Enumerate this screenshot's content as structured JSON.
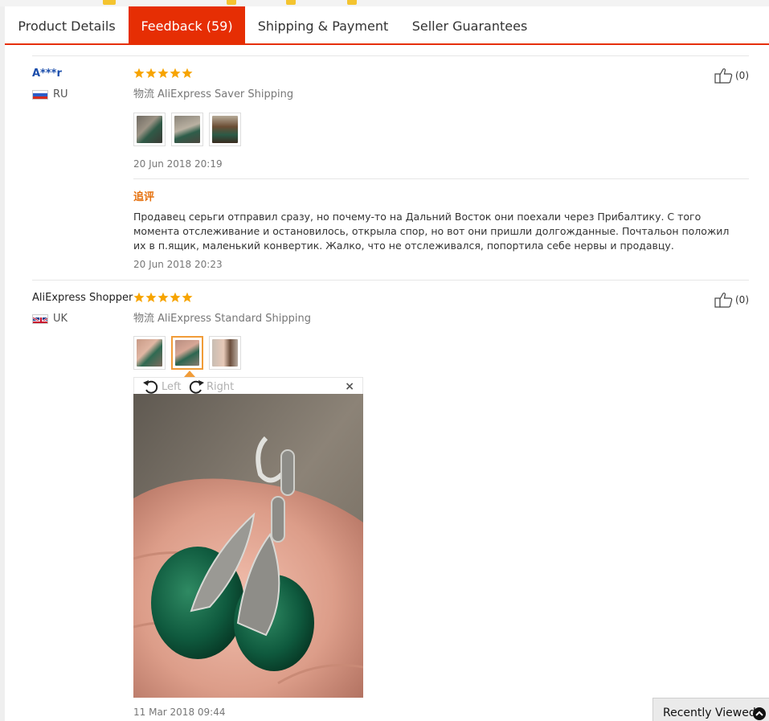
{
  "tabs": [
    {
      "label": "Product Details",
      "active": false
    },
    {
      "label": "Feedback (59)",
      "active": true
    },
    {
      "label": "Shipping & Payment",
      "active": false
    },
    {
      "label": "Seller Guarantees",
      "active": false
    }
  ],
  "reviews": [
    {
      "user": "A***r",
      "country": "RU",
      "rating": 5,
      "shipping_label": "物流",
      "shipping_method": "AliExpress Saver Shipping",
      "helpful_count": "(0)",
      "date": "20 Jun 2018 20:19",
      "append_title": "追评",
      "append_text": "Продавец серьги отправил сразу, но почему-то на Дальний Восток они поехали через Прибалтику. С того момента отслеживание и остановилось, открыла спор, но вот они пришли долгожданные. Почтальон положил их в п.ящик, маленький конвертик. Жалко, что не отслеживался, попортила себе нервы и продавцу.",
      "append_date": "20 Jun 2018 20:23"
    },
    {
      "user": "AliExpress Shopper",
      "country": "UK",
      "rating": 5,
      "shipping_label": "物流",
      "shipping_method": "AliExpress Standard Shipping",
      "helpful_count": "(0)",
      "date": "11 Mar 2018 09:44"
    }
  ],
  "viewer": {
    "rotate_left": "Left",
    "rotate_right": "Right",
    "close": "×"
  },
  "recently_viewed": "Recently Viewed",
  "colors": {
    "accent": "#e62e04",
    "star": "#f7a400",
    "append": "#e5710f",
    "link": "#1a4dab"
  }
}
